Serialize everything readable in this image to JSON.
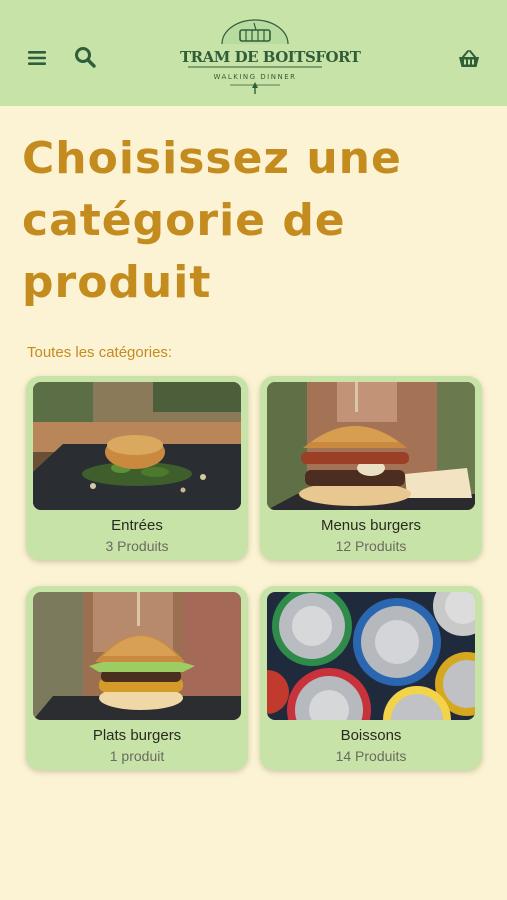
{
  "header": {
    "logo_title": "TRAM DE BOITSFORT",
    "logo_subtitle": "WALKING DINNER",
    "menu_icon": "hamburger-menu-icon",
    "search_icon": "search-icon",
    "basket_icon": "basket-icon",
    "color": "#2f5e3a",
    "background": "#c8e3a7"
  },
  "page": {
    "title": "Choisissez une catégorie de produit",
    "section_label": "Toutes les catégories:",
    "accent": "#c48b1f",
    "background": "#fbf3d3"
  },
  "categories": [
    {
      "name": "Entrées",
      "count": "3 Produits"
    },
    {
      "name": "Menus burgers",
      "count": "12 Produits"
    },
    {
      "name": "Plats burgers",
      "count": "1 produit"
    },
    {
      "name": "Boissons",
      "count": "14 Produits"
    }
  ]
}
